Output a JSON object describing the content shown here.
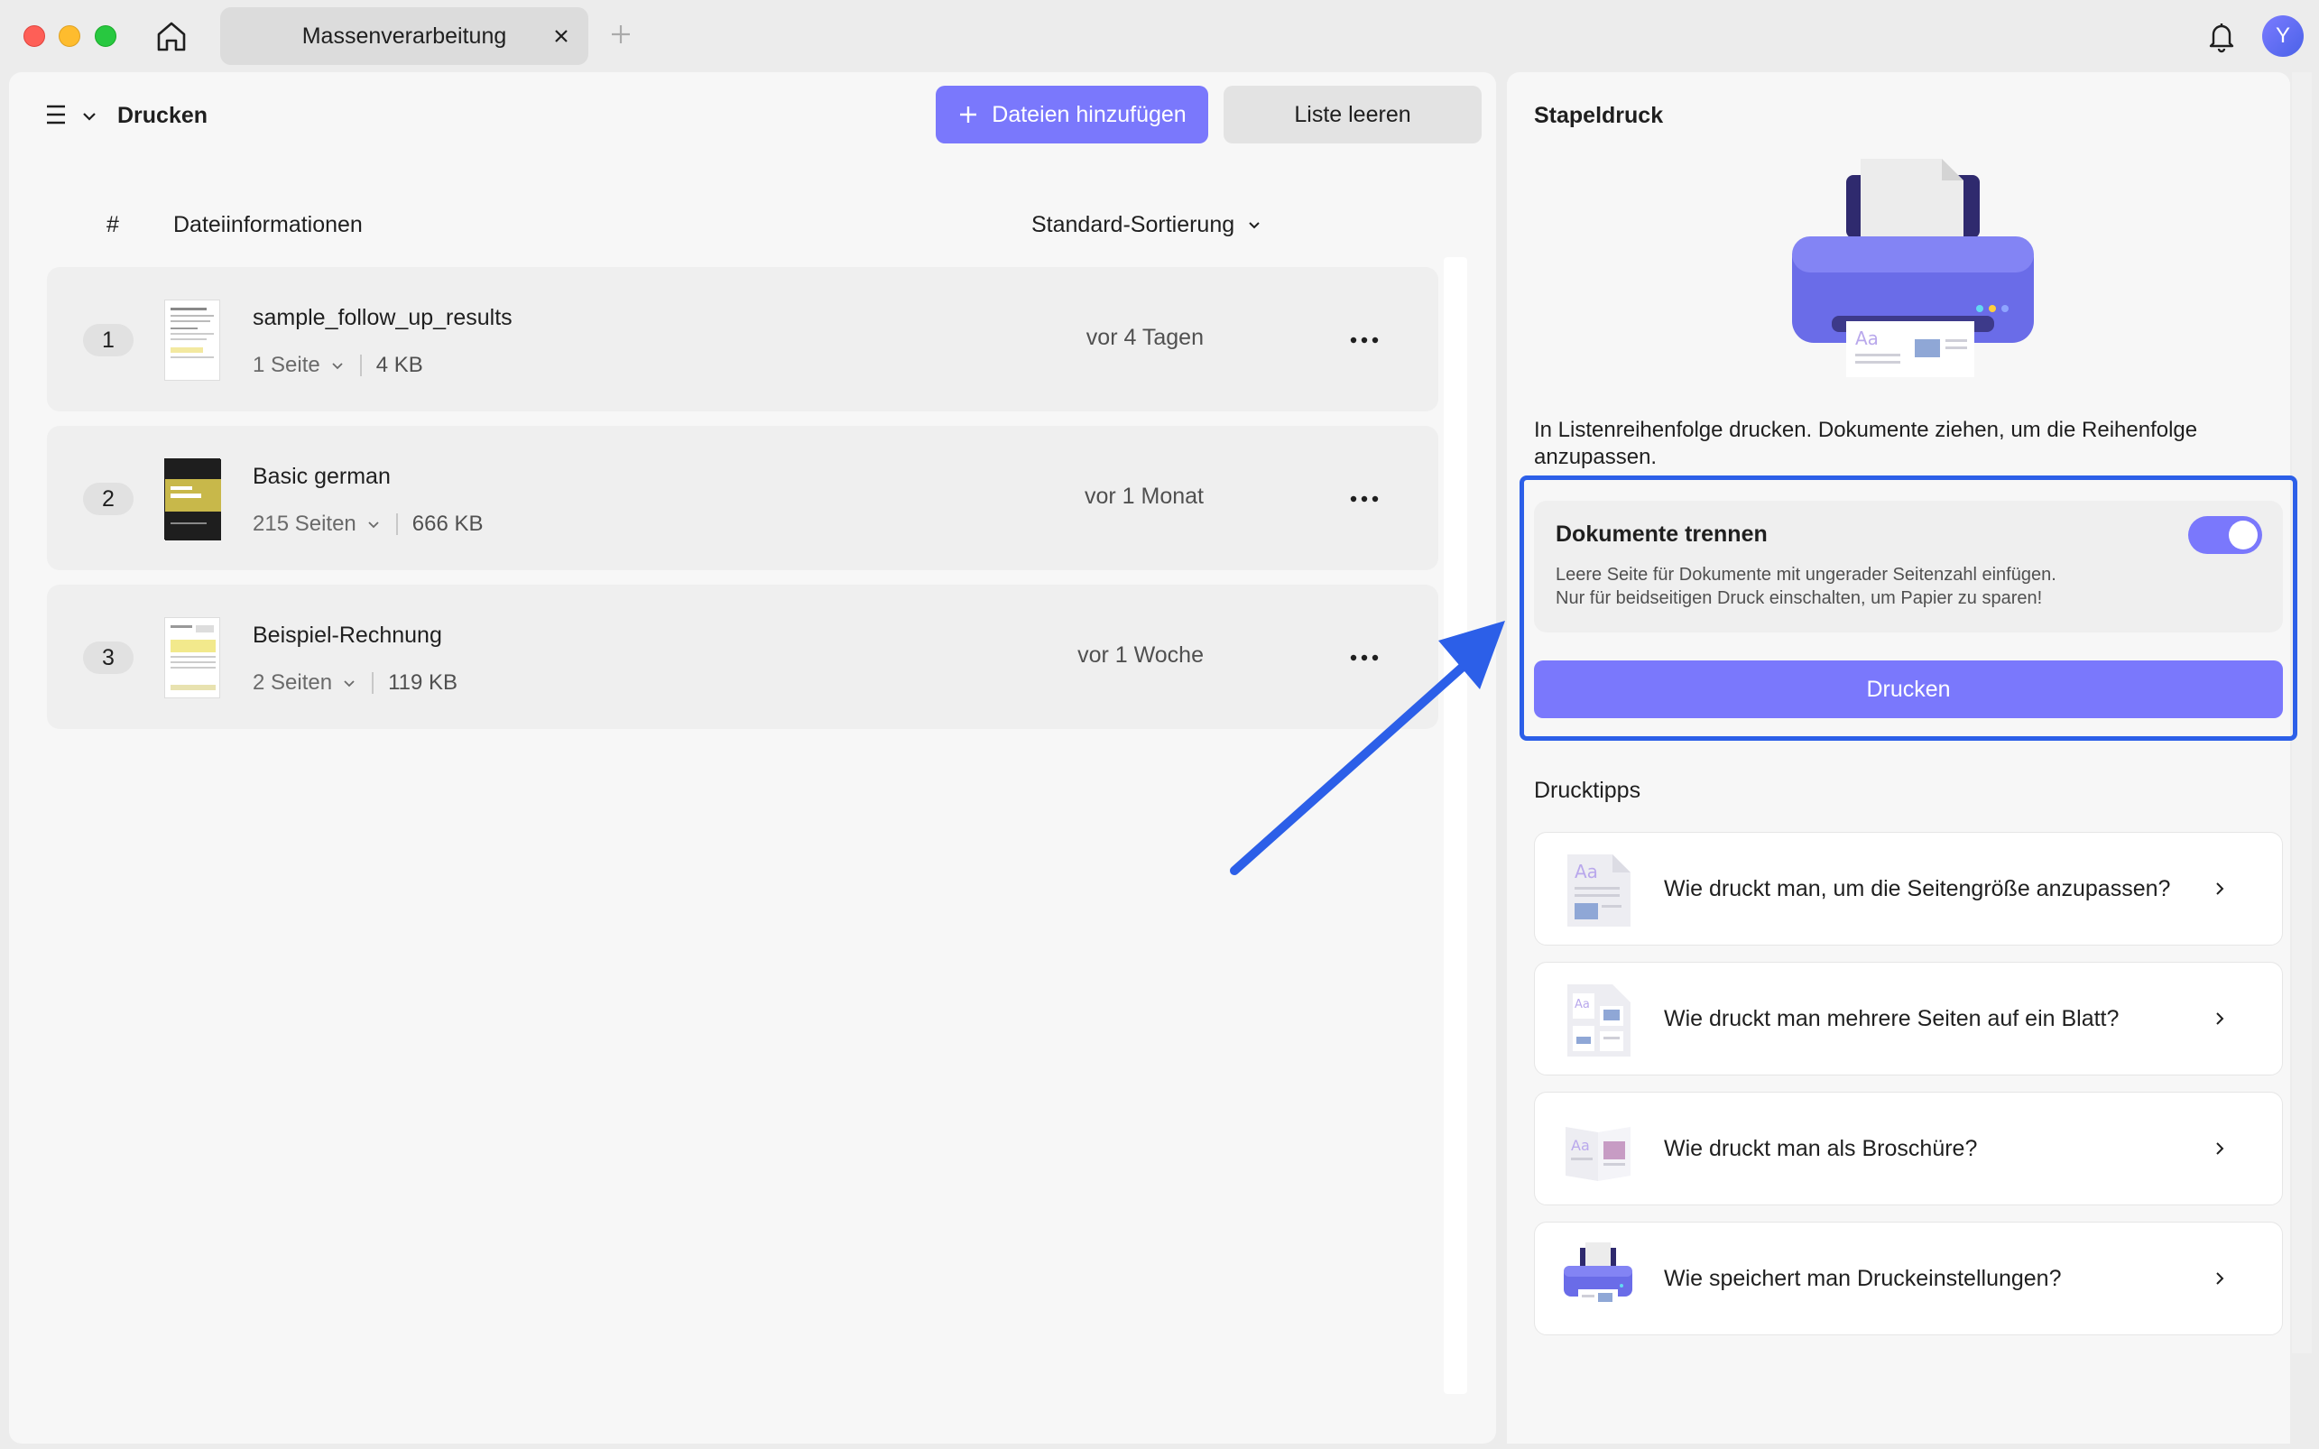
{
  "window": {
    "tab_title": "Massenverarbeitung",
    "avatar_initial": "Y"
  },
  "left": {
    "title": "Drucken",
    "add_files_label": "Dateien hinzufügen",
    "clear_list_label": "Liste leeren",
    "columns": {
      "hash": "#",
      "info": "Dateiinformationen"
    },
    "sort_label": "Standard-Sortierung",
    "files": [
      {
        "num": "1",
        "name": "sample_follow_up_results",
        "pages": "1 Seite",
        "size": "4 KB",
        "date": "vor 4 Tagen"
      },
      {
        "num": "2",
        "name": "Basic german",
        "pages": "215 Seiten",
        "size": "666 KB",
        "date": "vor 1 Monat"
      },
      {
        "num": "3",
        "name": "Beispiel-Rechnung",
        "pages": "2 Seiten",
        "size": "119 KB",
        "date": "vor 1 Woche"
      }
    ]
  },
  "right": {
    "title": "Stapeldruck",
    "description": "In Listenreihenfolge drucken. Dokumente ziehen, um die Reihenfolge anzupassen.",
    "separate": {
      "title": "Dokumente trennen",
      "line1": "Leere Seite für Dokumente mit ungerader Seitenzahl einfügen.",
      "line2": "Nur für beidseitigen Druck einschalten, um Papier zu sparen!",
      "enabled": true
    },
    "print_label": "Drucken",
    "tips_title": "Drucktipps",
    "tips": [
      {
        "label": "Wie druckt man, um die Seitengröße anzupassen?",
        "icon": "page-size-icon"
      },
      {
        "label": "Wie druckt man mehrere Seiten auf ein Blatt?",
        "icon": "multi-page-icon"
      },
      {
        "label": "Wie druckt man als Broschüre?",
        "icon": "booklet-icon"
      },
      {
        "label": "Wie speichert man Druckeinstellungen?",
        "icon": "printer-icon"
      }
    ]
  },
  "colors": {
    "accent": "#7a78fc",
    "highlight": "#2c5fe8"
  }
}
